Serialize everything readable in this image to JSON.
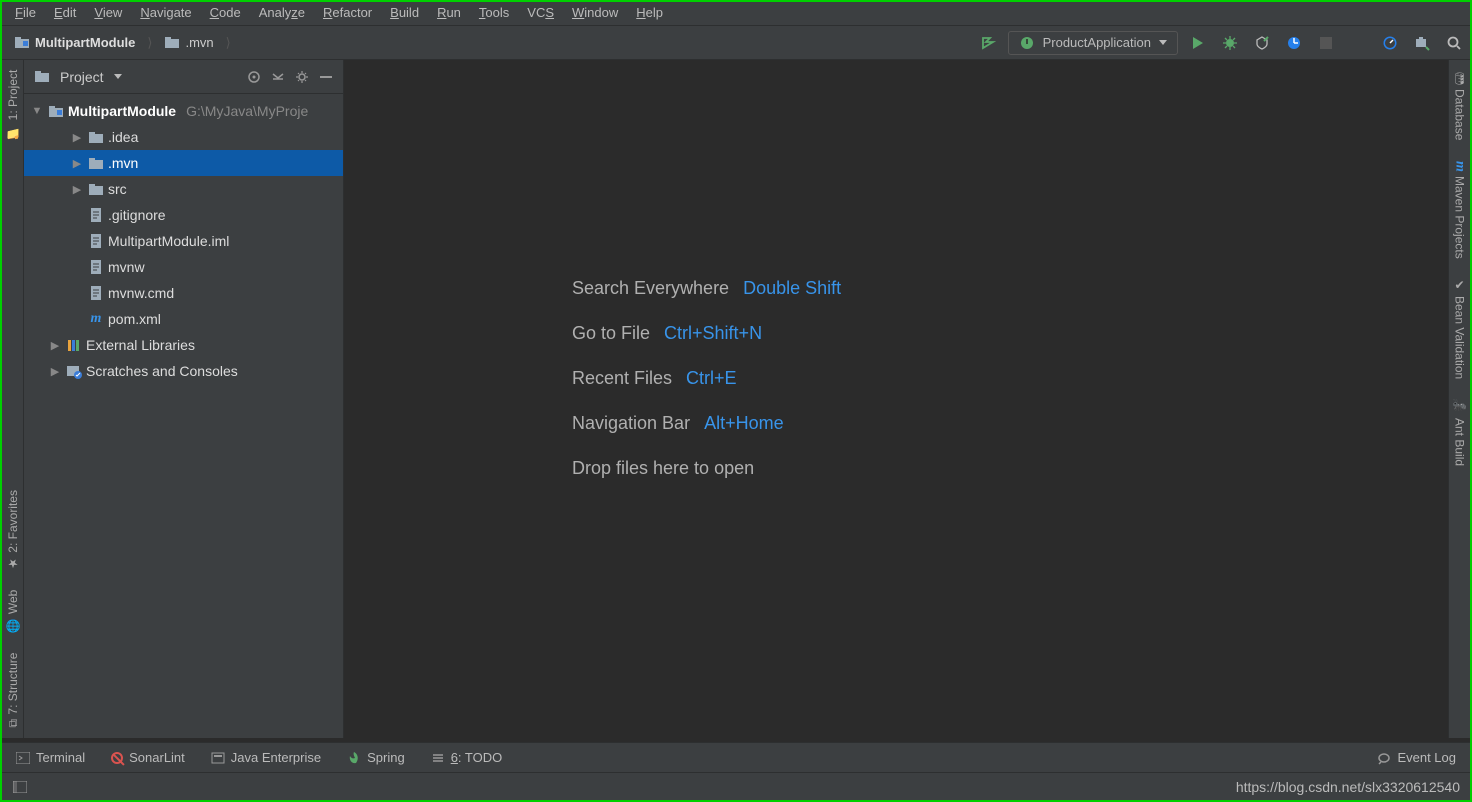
{
  "menu": [
    "File",
    "Edit",
    "View",
    "Navigate",
    "Code",
    "Analyze",
    "Refactor",
    "Build",
    "Run",
    "Tools",
    "VCS",
    "Window",
    "Help"
  ],
  "breadcrumbs": [
    "MultipartModule",
    ".mvn"
  ],
  "runConfig": "ProductApplication",
  "leftGutter": [
    "1: Project",
    "2: Favorites",
    "Web",
    "7: Structure"
  ],
  "rightGutter": [
    "Database",
    "Maven Projects",
    "Bean Validation",
    "Ant Build"
  ],
  "projectPanel": {
    "title": "Project",
    "rootName": "MultipartModule",
    "rootPath": "G:\\MyJava\\MyProje",
    "children": [
      {
        "icon": "folder",
        "name": ".idea",
        "expandable": true
      },
      {
        "icon": "folder",
        "name": ".mvn",
        "expandable": true,
        "selected": true
      },
      {
        "icon": "folder",
        "name": "src",
        "expandable": true
      },
      {
        "icon": "file",
        "name": ".gitignore"
      },
      {
        "icon": "file",
        "name": "MultipartModule.iml"
      },
      {
        "icon": "file",
        "name": "mvnw"
      },
      {
        "icon": "file",
        "name": "mvnw.cmd"
      },
      {
        "icon": "maven",
        "name": "pom.xml"
      }
    ],
    "extras": [
      "External Libraries",
      "Scratches and Consoles"
    ]
  },
  "placeholder": [
    {
      "label": "Search Everywhere",
      "shortcut": "Double Shift"
    },
    {
      "label": "Go to File",
      "shortcut": "Ctrl+Shift+N"
    },
    {
      "label": "Recent Files",
      "shortcut": "Ctrl+E"
    },
    {
      "label": "Navigation Bar",
      "shortcut": "Alt+Home"
    },
    {
      "label": "Drop files here to open",
      "shortcut": ""
    }
  ],
  "bottomTabs": [
    "Terminal",
    "SonarLint",
    "Java Enterprise",
    "Spring",
    "6: TODO"
  ],
  "eventLog": "Event Log",
  "watermark": "https://blog.csdn.net/slx3320612540"
}
